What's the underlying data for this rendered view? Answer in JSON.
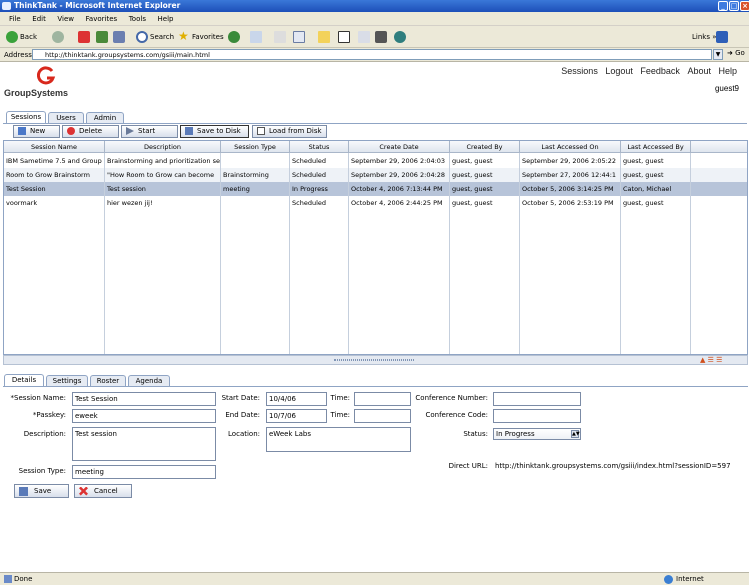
{
  "window": {
    "title": "ThinkTank - Microsoft Internet Explorer"
  },
  "menu": [
    "File",
    "Edit",
    "View",
    "Favorites",
    "Tools",
    "Help"
  ],
  "toolbar": {
    "back": "Back",
    "search": "Search",
    "favorites": "Favorites",
    "links": "Links",
    "go": "Go"
  },
  "address": {
    "label": "Address",
    "url": "http://thinktank.groupsystems.com/gsiii/main.html"
  },
  "app": {
    "logo_text": "GroupSystems",
    "username": "guest9",
    "nav": [
      "Sessions",
      "Logout",
      "Feedback",
      "About",
      "Help"
    ]
  },
  "tabs": [
    "Sessions",
    "Users",
    "Admin"
  ],
  "actions": [
    "New",
    "Delete",
    "Start",
    "Save to Disk",
    "Load from Disk"
  ],
  "columns": [
    "Session Name",
    "Description",
    "Session Type",
    "Status",
    "Create Date",
    "Created By",
    "Last Accessed On",
    "Last Accessed By"
  ],
  "rows": [
    [
      "IBM Sametime 7.5 and Group",
      "Brainstorming and prioritization se",
      "",
      "Scheduled",
      "September 29, 2006 2:04:03",
      "guest, guest",
      "September 29, 2006 2:05:22",
      "guest, guest"
    ],
    [
      "Room to Grow Brainstorm",
      "\"How Room to Grow can become",
      "Brainstorming",
      "Scheduled",
      "September 29, 2006 2:04:28",
      "guest, guest",
      "September 27, 2006 12:44:1",
      "guest, guest"
    ],
    [
      "Test Session",
      "Test session",
      "meeting",
      "In Progress",
      "October 4, 2006 7:13:44 PM",
      "guest, guest",
      "October 5, 2006 3:14:25 PM",
      "Caton, Michael"
    ],
    [
      "voormark",
      "hier wezen jij!",
      "",
      "Scheduled",
      "October 4, 2006 2:44:25 PM",
      "guest, guest",
      "October 5, 2006 2:53:19 PM",
      "guest, guest"
    ]
  ],
  "detail_tabs": [
    "Details",
    "Settings",
    "Roster",
    "Agenda"
  ],
  "details": {
    "session_name_label": "*Session Name:",
    "session_name": "Test Session",
    "passkey_label": "*Passkey:",
    "passkey": "eweek",
    "description_label": "Description:",
    "description": "Test session",
    "session_type_label": "Session Type:",
    "session_type": "meeting",
    "start_date_label": "Start Date:",
    "start_date": "10/4/06",
    "end_date_label": "End Date:",
    "end_date": "10/7/06",
    "time_label": "Time:",
    "start_time": "",
    "end_time": "",
    "location_label": "Location:",
    "location": "eWeek Labs",
    "conf_number_label": "Conference Number:",
    "conf_number": "",
    "conf_code_label": "Conference Code:",
    "conf_code": "",
    "status_label": "Status:",
    "status": "In Progress",
    "direct_url_label": "Direct URL:",
    "direct_url": "http://thinktank.groupsystems.com/gsiii/index.html?sessionID=597",
    "save": "Save",
    "cancel": "Cancel"
  },
  "statusbar": {
    "left": "Done",
    "zone": "Internet"
  }
}
